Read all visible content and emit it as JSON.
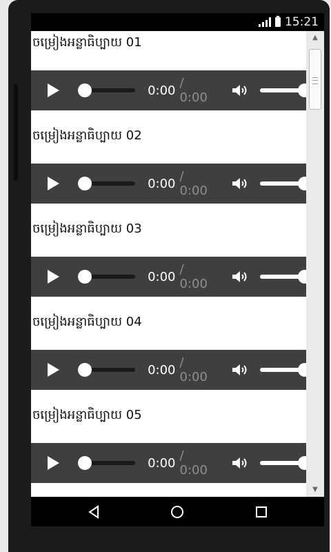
{
  "status_bar": {
    "time": "15:21"
  },
  "audio_items": [
    {
      "title": "ចម្រៀងអន្លាធិប្បាយ 01",
      "current_time": "0:00",
      "duration": "/ 0:00"
    },
    {
      "title": "ចម្រៀងអន្លាធិប្បាយ 02",
      "current_time": "0:00",
      "duration": "/ 0:00"
    },
    {
      "title": "ចម្រៀងអន្លាធិប្បាយ 03",
      "current_time": "0:00",
      "duration": "/ 0:00"
    },
    {
      "title": "ចម្រៀងអន្លាធិប្បាយ 04",
      "current_time": "0:00",
      "duration": "/ 0:00"
    },
    {
      "title": "ចម្រៀងអន្លាធិប្បាយ 05",
      "current_time": "0:00",
      "duration": "/ 0:00"
    }
  ],
  "nav_bar": {
    "icons": [
      "back-icon",
      "home-icon",
      "recents-icon"
    ]
  },
  "colors": {
    "player_bg": "#3f3f3f",
    "status_bar_bg": "#000000",
    "time_duration": "#8e8e8e"
  }
}
